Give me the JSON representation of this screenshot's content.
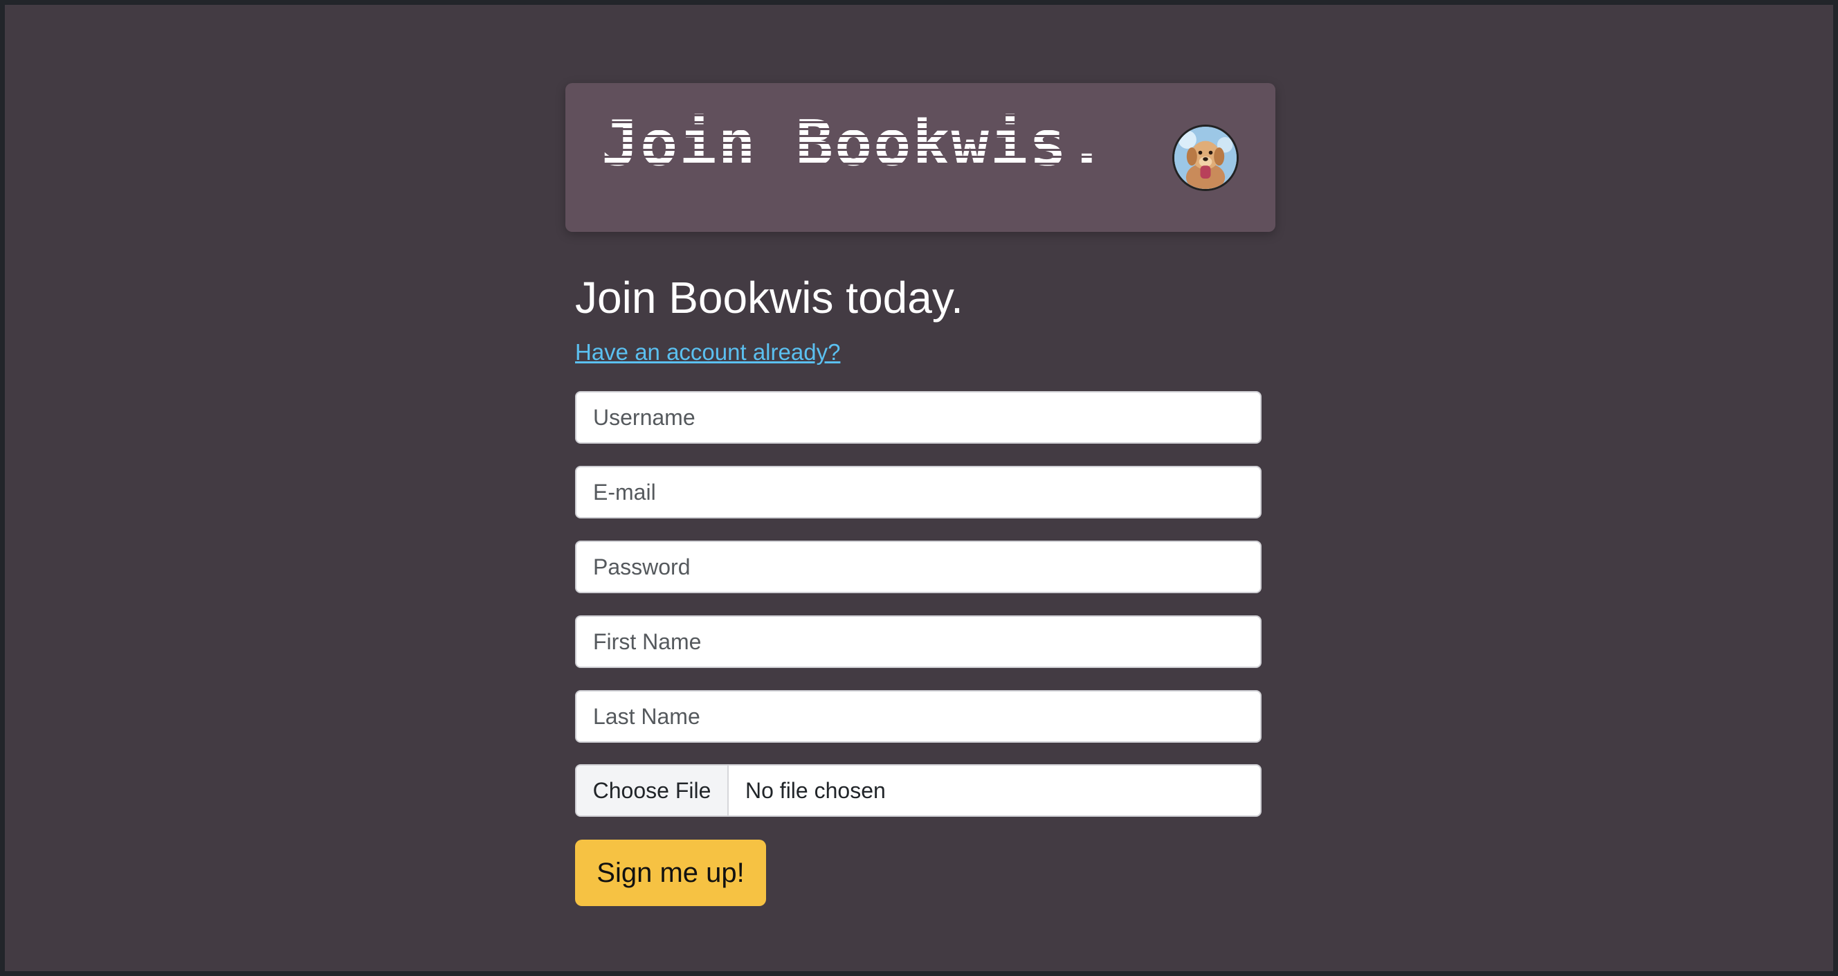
{
  "header": {
    "logo_text": "Join Bookwis.",
    "avatar_alt": "user avatar"
  },
  "main": {
    "heading": "Join Bookwis today.",
    "login_link": "Have an account already?"
  },
  "form": {
    "username_placeholder": "Username",
    "email_placeholder": "E-mail",
    "password_placeholder": "Password",
    "first_name_placeholder": "First Name",
    "last_name_placeholder": "Last Name",
    "file_button_label": "Choose File",
    "file_status": "No file chosen",
    "submit_label": "Sign me up!"
  },
  "colors": {
    "page_background": "#433b43",
    "header_background": "#61505c",
    "link": "#5bc0f0",
    "submit_button": "#f6c243"
  }
}
